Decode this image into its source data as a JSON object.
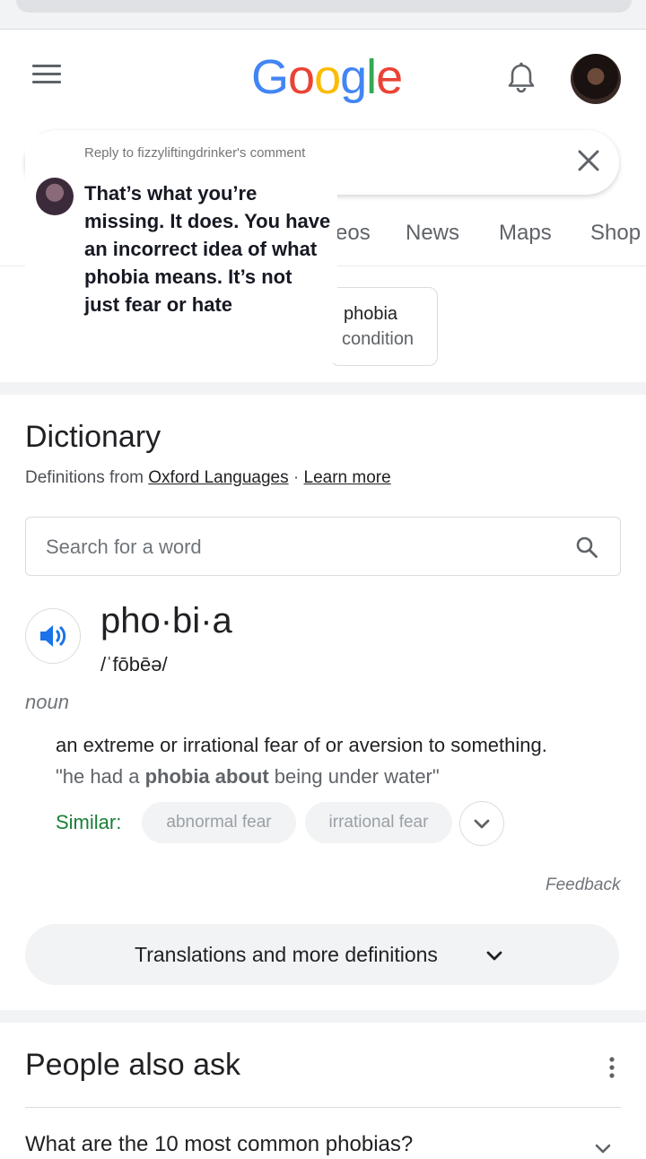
{
  "header": {
    "logo_text": "Google",
    "logo_colors": [
      "#4285F4",
      "#EA4335",
      "#FBBC05",
      "#4285F4",
      "#34A853",
      "#EA4335"
    ]
  },
  "tabs": [
    {
      "label": "eos"
    },
    {
      "label": "News"
    },
    {
      "label": "Maps"
    },
    {
      "label": "Shop"
    }
  ],
  "related_chip": {
    "line1": "phobia",
    "line2": "condition"
  },
  "comment_overlay": {
    "reply_label": "Reply to fizzyliftingdrinker's comment",
    "message": "That’s what you’re missing. It does. You have an incorrect idea of what phobia means. It’s not just fear or hate"
  },
  "dictionary": {
    "title": "Dictionary",
    "source_prefix": "Definitions from ",
    "source_link": "Oxford Languages",
    "separator": " · ",
    "learn_more": "Learn more",
    "search_placeholder": "Search for a word",
    "headword": "pho·bi·a",
    "pronunciation": "/ˈfōbēə/",
    "part_of_speech": "noun",
    "definition": "an extreme or irrational fear of or aversion to something.",
    "example_prefix": "\"he had a ",
    "example_bold": "phobia about",
    "example_suffix": " being under water\"",
    "similar_label": "Similar:",
    "similar": [
      "abnormal fear",
      "irrational fear"
    ],
    "feedback": "Feedback",
    "more_button": "Translations and more definitions"
  },
  "people_also_ask": {
    "title": "People also ask",
    "first_question": "What are the 10 most common phobias?"
  },
  "colors": {
    "accent_blue": "#1a73e8",
    "similar_green": "#188038"
  }
}
